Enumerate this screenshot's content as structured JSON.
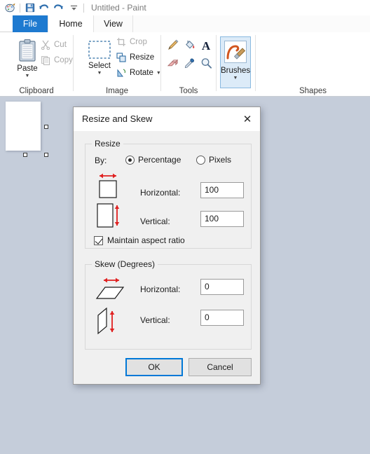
{
  "window": {
    "title": "Untitled - Paint",
    "qat": [
      {
        "name": "paint-app-icon",
        "label": "Paint"
      },
      {
        "name": "save-icon",
        "label": "Save"
      },
      {
        "name": "undo-icon",
        "label": "Undo"
      },
      {
        "name": "redo-icon",
        "label": "Redo"
      },
      {
        "name": "customize-quick-access-toolbar-icon",
        "label": "Customize Quick Access Toolbar"
      }
    ]
  },
  "tabs": [
    {
      "label": "File",
      "id": "file",
      "active": false
    },
    {
      "label": "Home",
      "id": "home",
      "active": true
    },
    {
      "label": "View",
      "id": "view",
      "active": false
    }
  ],
  "ribbon": {
    "groups": [
      {
        "id": "clipboard",
        "label": "Clipboard",
        "paste": {
          "label": "Paste",
          "icon": "clipboard-icon"
        },
        "items": [
          {
            "label": "Cut",
            "icon": "scissors-icon",
            "disabled": true
          },
          {
            "label": "Copy",
            "icon": "copy-icon",
            "disabled": true
          }
        ]
      },
      {
        "id": "image",
        "label": "Image",
        "select": {
          "label": "Select",
          "icon": "selection-rectangle-icon"
        },
        "items": [
          {
            "label": "Crop",
            "icon": "crop-icon",
            "disabled": true
          },
          {
            "label": "Resize",
            "icon": "resize-icon",
            "disabled": false
          },
          {
            "label": "Rotate",
            "icon": "rotate-icon",
            "disabled": false
          }
        ]
      },
      {
        "id": "tools",
        "label": "Tools",
        "items": [
          {
            "label": "Pencil",
            "icon": "pencil-icon"
          },
          {
            "label": "Fill with color",
            "icon": "paint-bucket-icon"
          },
          {
            "label": "Text",
            "icon": "text-a-icon"
          },
          {
            "label": "Eraser",
            "icon": "eraser-icon"
          },
          {
            "label": "Color picker",
            "icon": "eyedropper-icon"
          },
          {
            "label": "Magnifier",
            "icon": "magnifier-icon"
          }
        ]
      },
      {
        "id": "brushes",
        "label": "",
        "brushes": {
          "label": "Brushes",
          "icon": "paintbrush-icon",
          "selected": true
        }
      },
      {
        "id": "shapes",
        "label": "Shapes",
        "items": [
          {
            "icon": "line-shape-icon"
          },
          {
            "icon": "curve-shape-icon"
          },
          {
            "icon": "oval-shape-icon"
          },
          {
            "icon": "rectangle-shape-icon"
          },
          {
            "icon": "rounded-rectangle-shape-icon"
          },
          {
            "icon": "polygon-shape-icon"
          },
          {
            "icon": "triangle-shape-icon"
          },
          {
            "icon": "right-triangle-shape-icon"
          },
          {
            "icon": "diamond-shape-icon"
          },
          {
            "icon": "pentagon-shape-icon"
          },
          {
            "icon": "hexagon-shape-icon"
          },
          {
            "icon": "right-arrow-shape-icon"
          },
          {
            "icon": "left-arrow-shape-icon"
          },
          {
            "icon": "up-arrow-shape-icon"
          },
          {
            "icon": "down-arrow-shape-icon"
          },
          {
            "icon": "four-point-star-shape-icon"
          },
          {
            "icon": "five-point-star-shape-icon"
          },
          {
            "icon": "six-point-star-shape-icon"
          },
          {
            "icon": "rectangular-callout-shape-icon"
          },
          {
            "icon": "rounded-rectangular-callout-shape-icon"
          },
          {
            "icon": "cloud-callout-shape-icon"
          }
        ],
        "scroll": [
          {
            "icon": "scroll-up-icon"
          },
          {
            "icon": "scroll-down-icon"
          },
          {
            "icon": "more-shapes-icon"
          }
        ]
      }
    ]
  },
  "canvas": {
    "name": "drawing-canvas",
    "handles": [
      "right-resize-handle",
      "bottom-resize-handle",
      "corner-resize-handle"
    ]
  },
  "dialog": {
    "title": "Resize and Skew",
    "close_label": "✕",
    "resize": {
      "group_label": "Resize",
      "by_label": "By:",
      "options": [
        {
          "label": "Percentage",
          "selected": true
        },
        {
          "label": "Pixels",
          "selected": false
        }
      ],
      "horizontal_label": "Horizontal:",
      "horizontal_value": "100",
      "vertical_label": "Vertical:",
      "vertical_value": "100",
      "maintain_label": "Maintain aspect ratio",
      "maintain_checked": true,
      "horizontal_icon": "horizontal-resize-preview-icon",
      "vertical_icon": "vertical-resize-preview-icon"
    },
    "skew": {
      "group_label": "Skew (Degrees)",
      "horizontal_label": "Horizontal:",
      "horizontal_value": "0",
      "vertical_label": "Vertical:",
      "vertical_value": "0",
      "horizontal_icon": "horizontal-skew-preview-icon",
      "vertical_icon": "vertical-skew-preview-icon"
    },
    "buttons": {
      "ok": "OK",
      "cancel": "Cancel"
    }
  },
  "colors": {
    "accent": "#0078d7",
    "file_tab": "#1e7ad0",
    "workspace_bg": "#c5cdda",
    "dialog_bg": "#f0f0f0",
    "ribbon_bg": "#ffffff",
    "marker_red": "#e02020",
    "shape_blue": "#2e6da4"
  }
}
